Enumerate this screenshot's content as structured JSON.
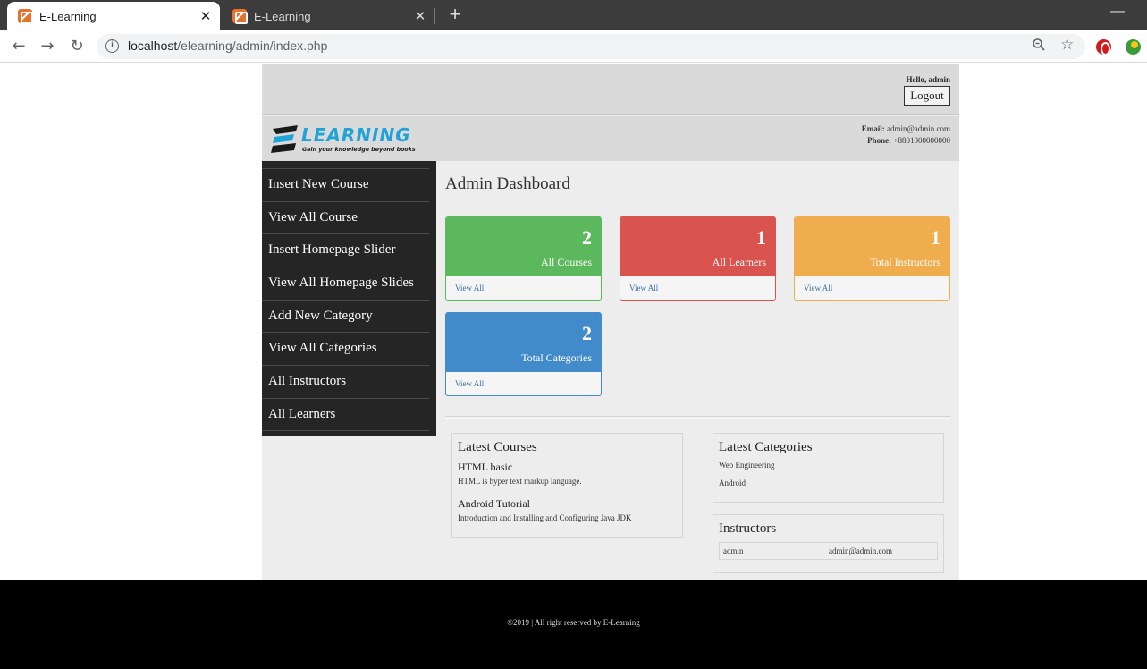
{
  "browser": {
    "tabs": [
      {
        "title": "E-Learning",
        "active": true
      },
      {
        "title": "E-Learning",
        "active": false
      }
    ],
    "url_host": "localhost",
    "url_path": "/elearning/admin/index.php"
  },
  "header": {
    "greeting": "Hello, admin",
    "logout_label": "Logout",
    "logo_text": "ELEARNING",
    "logo_tagline": "Gain your knowledge beyond books",
    "email_label": "Email:",
    "email": "admin@admin.com",
    "phone_label": "Phone:",
    "phone": "+8801000000000"
  },
  "sidebar": {
    "items": [
      {
        "label": "Insert New Course"
      },
      {
        "label": "View All Course"
      },
      {
        "label": "Insert Homepage Slider"
      },
      {
        "label": "View All Homepage Slides"
      },
      {
        "label": "Add New Category"
      },
      {
        "label": "View All Categories"
      },
      {
        "label": "All Instructors"
      },
      {
        "label": "All Learners"
      }
    ]
  },
  "main": {
    "title": "Admin Dashboard",
    "cards": [
      {
        "count": "2",
        "label": "All Courses",
        "link": "View All",
        "color": "#5cb85c"
      },
      {
        "count": "1",
        "label": "All Learners",
        "link": "View All",
        "color": "#d9534f"
      },
      {
        "count": "1",
        "label": "Total Instructors",
        "link": "View All",
        "color": "#f0ad4e"
      },
      {
        "count": "2",
        "label": "Total Categories",
        "link": "View All",
        "color": "#428bca"
      }
    ],
    "latest_courses": {
      "title": "Latest Courses",
      "items": [
        {
          "title": "HTML basic",
          "desc": "HTML is hyper text markup language."
        },
        {
          "title": "Android Tutorial",
          "desc": "Introduction and Installing and Configuring Java JDK"
        }
      ]
    },
    "latest_categories": {
      "title": "Latest Categories",
      "items": [
        "Web Engineering",
        "Android"
      ]
    },
    "instructors": {
      "title": "Instructors",
      "rows": [
        {
          "name": "admin",
          "email": "admin@admin.com"
        }
      ]
    }
  },
  "footer": {
    "text": "©2019 | All right reserved by E-Learning"
  }
}
